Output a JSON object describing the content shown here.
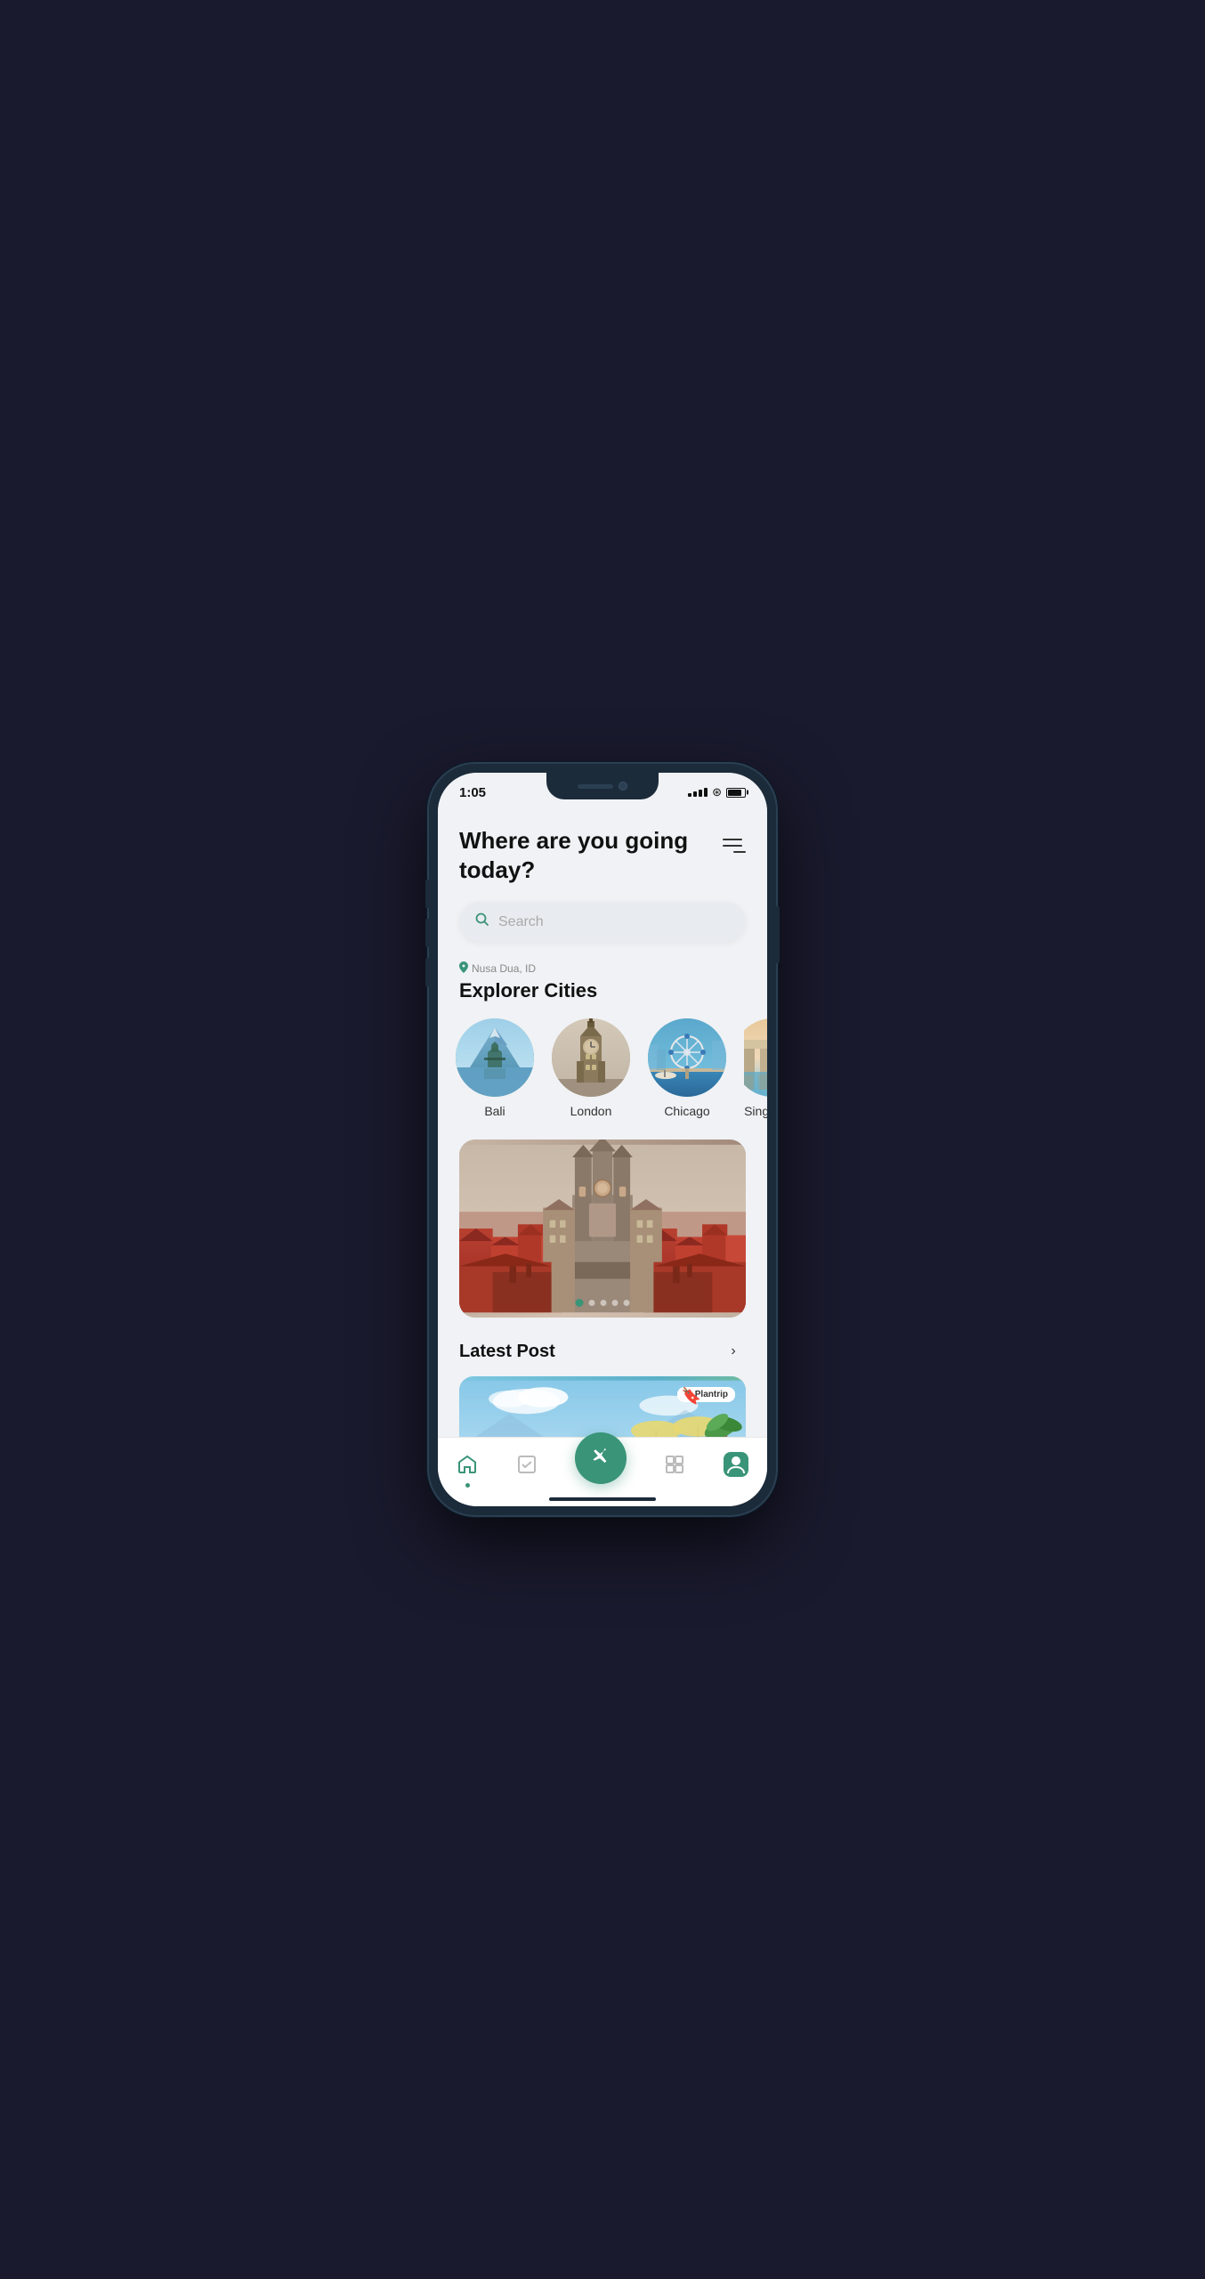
{
  "status": {
    "time": "1:05",
    "battery_level": 85
  },
  "header": {
    "title": "Where are you going today?",
    "menu_label": "menu"
  },
  "search": {
    "placeholder": "Search"
  },
  "location": {
    "text": "Nusa Dua, ID"
  },
  "explorer_section": {
    "label": "Explorer Cities",
    "cities": [
      {
        "name": "Bali",
        "style": "bali"
      },
      {
        "name": "London",
        "style": "london"
      },
      {
        "name": "Chicago",
        "style": "chicago"
      },
      {
        "name": "Singapore",
        "style": "singapore"
      }
    ]
  },
  "featured": {
    "carousel_dots": 5,
    "active_dot": 0
  },
  "latest_post": {
    "title": "Latest Post",
    "see_more": "›",
    "plantrip_label": "Plantrip"
  },
  "nav": {
    "items": [
      {
        "name": "home",
        "icon": "⌂",
        "active": true
      },
      {
        "name": "tasks",
        "icon": "☑",
        "active": false
      },
      {
        "name": "center",
        "icon": "✈",
        "active": false,
        "center": true
      },
      {
        "name": "pages",
        "icon": "⧉",
        "active": false
      },
      {
        "name": "profile",
        "icon": "◉",
        "active": false
      }
    ]
  }
}
